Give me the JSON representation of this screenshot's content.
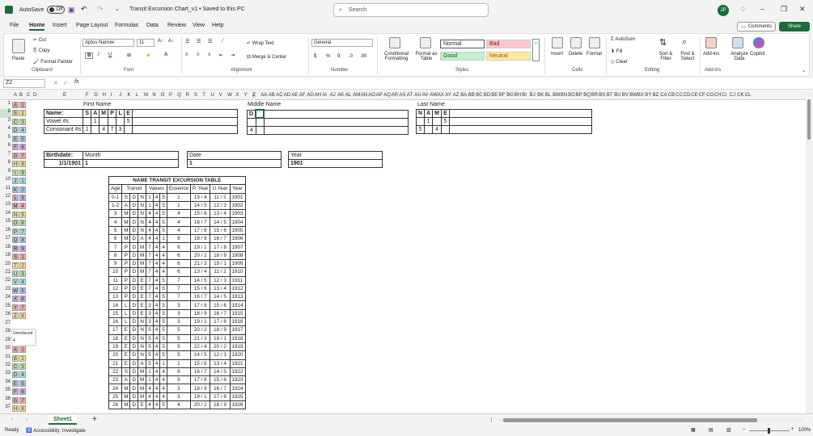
{
  "titlebar": {
    "autosave_label": "AutoSave",
    "autosave_state": "Off",
    "doc_title": "Transit Excursion Chart_v1 • Saved to this PC",
    "search_placeholder": "Search",
    "user_initials": "JP"
  },
  "menu": {
    "tabs": [
      "File",
      "Home",
      "Insert",
      "Page Layout",
      "Formulas",
      "Data",
      "Review",
      "View",
      "Help"
    ],
    "active": "Home",
    "comments_label": "Comments",
    "share_label": "Share"
  },
  "ribbon": {
    "clipboard": {
      "paste": "Paste",
      "cut": "Cut",
      "copy": "Copy",
      "format_painter": "Format Painter",
      "group": "Clipboard"
    },
    "font": {
      "name": "Aptos Narrow",
      "size": "11",
      "group": "Font"
    },
    "alignment": {
      "wrap": "Wrap Text",
      "merge": "Merge & Center",
      "group": "Alignment"
    },
    "number": {
      "format": "General",
      "group": "Number"
    },
    "styles": {
      "conditional": "Conditional Formatting",
      "format_table": "Format as Table",
      "normal": "Normal",
      "bad": "Bad",
      "good": "Good",
      "neutral": "Neutral",
      "group": "Styles"
    },
    "cells": {
      "insert": "Insert",
      "delete": "Delete",
      "format": "Format",
      "group": "Cells"
    },
    "editing": {
      "autosum": "AutoSum",
      "fill": "Fill",
      "clear": "Clear",
      "sort": "Sort & Filter",
      "find": "Find & Select",
      "group": "Editing"
    },
    "addins": {
      "addins": "Add-ins",
      "analyze": "Analyze Data",
      "copilot": "Copilot",
      "group": "Add-ins"
    }
  },
  "formula": {
    "namebox": "Z2",
    "fx": "fx",
    "value": ""
  },
  "columns": [
    "A",
    "B",
    "C",
    "D",
    "E",
    "F",
    "G",
    "H",
    "I",
    "J",
    "K",
    "L",
    "M",
    "N",
    "O",
    "P",
    "Q",
    "R",
    "S",
    "T",
    "U",
    "V",
    "W",
    "X",
    "Y",
    "Z",
    "AA",
    "AB",
    "AC",
    "AD",
    "AE",
    "AF",
    "AG",
    "AH",
    "AI",
    "AJ",
    "AK",
    "AL",
    "AM",
    "AN",
    "AO",
    "AP",
    "AQ",
    "AR",
    "AS",
    "AT",
    "AU",
    "AV",
    "AW",
    "AX",
    "AY",
    "AZ",
    "BA",
    "BB",
    "BC",
    "BD",
    "BE",
    "BF",
    "BG",
    "BH",
    "BI",
    "BJ",
    "BK",
    "BL",
    "BM",
    "BN",
    "BO",
    "BP",
    "BQ",
    "BR",
    "BS",
    "BT",
    "BU",
    "BV",
    "BW",
    "BX",
    "BY",
    "BZ",
    "CA",
    "CB",
    "CC",
    "CD",
    "CE",
    "CF",
    "CG",
    "CH",
    "CI",
    "CJ",
    "CK",
    "CL"
  ],
  "letters_col": [
    [
      "A",
      "1"
    ],
    [
      "B",
      "2"
    ],
    [
      "C",
      "3"
    ],
    [
      "D",
      "4"
    ],
    [
      "E",
      "5"
    ],
    [
      "F",
      "6"
    ],
    [
      "G",
      "7"
    ],
    [
      "H",
      "8"
    ],
    [
      "I",
      "9"
    ],
    [
      "J",
      "1"
    ],
    [
      "K",
      "2"
    ],
    [
      "L",
      "3"
    ],
    [
      "M",
      "4"
    ],
    [
      "N",
      "5"
    ],
    [
      "O",
      "6"
    ],
    [
      "P",
      "7"
    ],
    [
      "Q",
      "8"
    ],
    [
      "R",
      "9"
    ],
    [
      "S",
      "1"
    ],
    [
      "T",
      "2"
    ],
    [
      "U",
      "3"
    ],
    [
      "V",
      "4"
    ],
    [
      "W",
      "5"
    ],
    [
      "X",
      "6"
    ],
    [
      "Y",
      "7"
    ],
    [
      "Z",
      "8"
    ]
  ],
  "letters_col2": [
    [
      "A",
      "1"
    ],
    [
      "B",
      "2"
    ],
    [
      "C",
      "3"
    ],
    [
      "D",
      "4"
    ],
    [
      "E",
      "5"
    ],
    [
      "F",
      "6"
    ],
    [
      "G",
      "7"
    ],
    [
      "H",
      "8"
    ]
  ],
  "unreduced": {
    "label": "Unreduced",
    "value": "4"
  },
  "sections": {
    "first_name": "First Name",
    "middle_name": "Middle Name",
    "last_name": "Last Name",
    "name_label": "Name:",
    "vowel_label": "Vowel #s",
    "consonant_label": "Consonant #s",
    "first_letters": [
      "S",
      "A",
      "M",
      "P",
      "L",
      "E"
    ],
    "first_vowels": [
      "",
      "1",
      "",
      "",
      "",
      "5"
    ],
    "first_consonants": [
      "1",
      "",
      "4",
      "7",
      "3",
      ""
    ],
    "middle_letters": [
      "D"
    ],
    "middle_consonants": [
      "4"
    ],
    "last_letters": [
      "N",
      "A",
      "M",
      "E"
    ],
    "last_vowels": [
      "",
      "1",
      "",
      "5"
    ],
    "last_consonants": [
      "5",
      "",
      "4",
      ""
    ],
    "birthdate_label": "Birthdate:",
    "birthdate_value": "1/1/1901",
    "month_label": "Month",
    "month_value": "1",
    "date_label": "Date",
    "date_value": "1",
    "year_label": "Year",
    "year_value": "1901"
  },
  "excursion": {
    "title": "NAME TRANSIT EXCURSION TABLE",
    "headers": [
      "Age",
      "Transit",
      "Values",
      "Essence",
      "P. Year",
      "U.Year",
      "Year"
    ],
    "rows": [
      [
        "0-1",
        "S",
        "D",
        "N",
        "1",
        "4",
        "5",
        "1",
        "13 / 4",
        "11 / 2",
        "1901"
      ],
      [
        "1-2",
        "A",
        "D",
        "N",
        "1",
        "4",
        "5",
        "1",
        "14 / 5",
        "12 / 3",
        "1902"
      ],
      [
        "3",
        "M",
        "D",
        "N",
        "4",
        "4",
        "5",
        "4",
        "15 / 6",
        "13 / 4",
        "1903"
      ],
      [
        "4",
        "M",
        "D",
        "N",
        "4",
        "4",
        "5",
        "4",
        "16 / 7",
        "14 / 5",
        "1904"
      ],
      [
        "5",
        "M",
        "D",
        "N",
        "4",
        "4",
        "5",
        "4",
        "17 / 8",
        "15 / 6",
        "1905"
      ],
      [
        "6",
        "M",
        "D",
        "A",
        "4",
        "4",
        "1",
        "9",
        "18 / 9",
        "16 / 7",
        "1906"
      ],
      [
        "7",
        "P",
        "D",
        "M",
        "7",
        "4",
        "4",
        "6",
        "19 / 1",
        "17 / 8",
        "1907"
      ],
      [
        "8",
        "P",
        "D",
        "M",
        "7",
        "4",
        "4",
        "6",
        "20 / 2",
        "18 / 9",
        "1908"
      ],
      [
        "9",
        "P",
        "D",
        "M",
        "7",
        "4",
        "4",
        "6",
        "21 / 3",
        "19 / 1",
        "1909"
      ],
      [
        "10",
        "P",
        "D",
        "M",
        "7",
        "4",
        "4",
        "6",
        "13 / 4",
        "11 / 2",
        "1910"
      ],
      [
        "11",
        "P",
        "D",
        "E",
        "7",
        "4",
        "5",
        "7",
        "14 / 5",
        "12 / 3",
        "1911"
      ],
      [
        "12",
        "P",
        "D",
        "E",
        "7",
        "4",
        "5",
        "7",
        "15 / 6",
        "13 / 4",
        "1912"
      ],
      [
        "13",
        "P",
        "D",
        "E",
        "7",
        "4",
        "5",
        "7",
        "16 / 7",
        "14 / 5",
        "1913"
      ],
      [
        "14",
        "L",
        "D",
        "E",
        "3",
        "4",
        "5",
        "3",
        "17 / 8",
        "15 / 6",
        "1914"
      ],
      [
        "15",
        "L",
        "D",
        "E",
        "3",
        "4",
        "5",
        "3",
        "18 / 9",
        "16 / 7",
        "1915"
      ],
      [
        "16",
        "L",
        "D",
        "N",
        "3",
        "4",
        "5",
        "3",
        "19 / 1",
        "17 / 8",
        "1916"
      ],
      [
        "17",
        "E",
        "D",
        "N",
        "5",
        "4",
        "5",
        "5",
        "20 / 2",
        "18 / 9",
        "1917"
      ],
      [
        "18",
        "E",
        "D",
        "N",
        "5",
        "4",
        "5",
        "5",
        "21 / 3",
        "19 / 1",
        "1918"
      ],
      [
        "19",
        "E",
        "D",
        "N",
        "5",
        "4",
        "5",
        "5",
        "22 / 4",
        "20 / 2",
        "1919"
      ],
      [
        "20",
        "E",
        "D",
        "N",
        "5",
        "4",
        "5",
        "5",
        "14 / 5",
        "12 / 3",
        "1920"
      ],
      [
        "21",
        "E",
        "D",
        "A",
        "5",
        "4",
        "1",
        "1",
        "15 / 6",
        "13 / 4",
        "1921"
      ],
      [
        "22",
        "S",
        "D",
        "M",
        "1",
        "4",
        "4",
        "9",
        "16 / 7",
        "14 / 5",
        "1922"
      ],
      [
        "23",
        "A",
        "D",
        "M",
        "1",
        "4",
        "4",
        "9",
        "17 / 8",
        "15 / 6",
        "1923"
      ],
      [
        "24",
        "M",
        "D",
        "M",
        "4",
        "4",
        "4",
        "3",
        "18 / 9",
        "16 / 7",
        "1924"
      ],
      [
        "25",
        "M",
        "D",
        "M",
        "4",
        "4",
        "4",
        "3",
        "19 / 1",
        "17 / 8",
        "1925"
      ],
      [
        "26",
        "M",
        "D",
        "E",
        "4",
        "4",
        "5",
        "4",
        "20 / 2",
        "18 / 9",
        "1926"
      ]
    ]
  },
  "tabs": {
    "sheet": "Sheet1"
  },
  "status": {
    "ready": "Ready",
    "accessibility": "Accessibility: Investigate",
    "zoom": "100%"
  },
  "colors": {
    "green": "#1d6b3a",
    "pink": "#f4a7a7",
    "yellow": "#f7e58a",
    "lgreen": "#bde4a8",
    "cyan": "#9fe0e6",
    "lblue": "#a8c6f0",
    "purple": "#c9a8e8"
  }
}
